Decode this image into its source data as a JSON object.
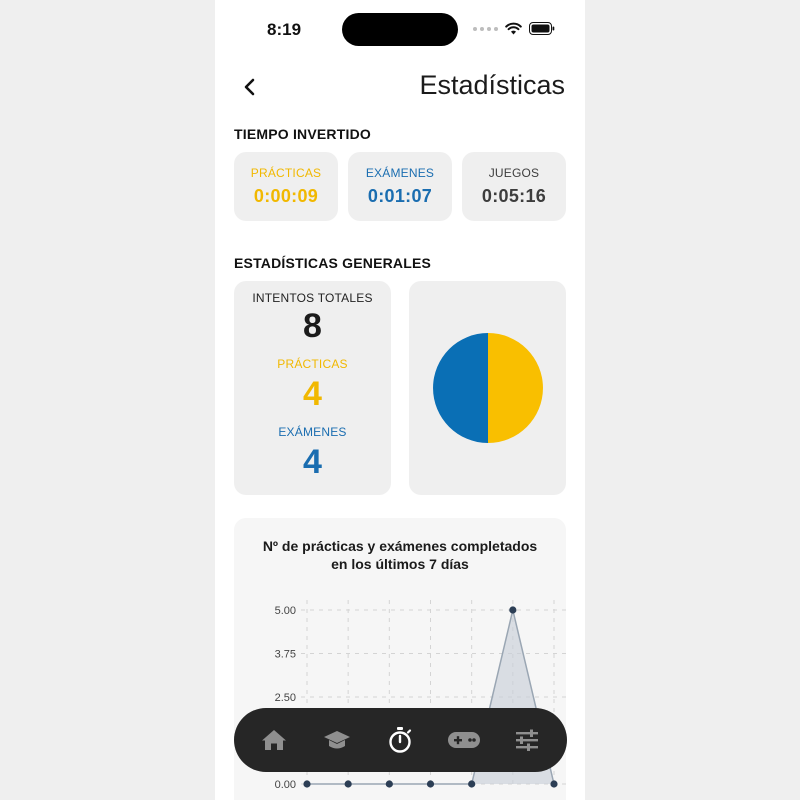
{
  "status_bar": {
    "time": "8:19"
  },
  "header": {
    "title": "Estadísticas",
    "back_icon": "chevron-left-icon"
  },
  "time_spent": {
    "title": "TIEMPO INVERTIDO",
    "cards": [
      {
        "label": "PRÁCTICAS",
        "value": "0:00:09",
        "color": "#f1b800"
      },
      {
        "label": "EXÁMENES",
        "value": "0:01:07",
        "color": "#1a6db0"
      },
      {
        "label": "JUEGOS",
        "value": "0:05:16",
        "color": "#3d3d3d"
      }
    ]
  },
  "general_stats": {
    "title": "ESTADÍSTICAS GENERALES",
    "total_label": "INTENTOS TOTALES",
    "total_value": "8",
    "practices_label": "PRÁCTICAS",
    "practices_value": "4",
    "exams_label": "EXÁMENES",
    "exams_value": "4"
  },
  "pie": {
    "slices": [
      {
        "value": 4,
        "color": "#f9bf00"
      },
      {
        "value": 4,
        "color": "#0a6fb5"
      }
    ]
  },
  "chart_data": {
    "type": "area",
    "title": "Nº de prácticas y exámenes completados en los últimos 7 días",
    "ytick_labels": [
      "5.00",
      "3.75",
      "2.50",
      "0.00"
    ],
    "ylim": [
      0,
      5
    ],
    "series": [
      {
        "values": [
          0,
          0,
          0,
          0,
          0,
          5,
          0
        ]
      }
    ],
    "grid": true
  },
  "nav": {
    "items": [
      {
        "icon": "home-icon",
        "active": false
      },
      {
        "icon": "graduation-cap-icon",
        "active": false
      },
      {
        "icon": "stopwatch-icon",
        "active": true
      },
      {
        "icon": "gamepad-icon",
        "active": false
      },
      {
        "icon": "sliders-icon",
        "active": false
      }
    ]
  },
  "colors": {
    "accent_yellow": "#f1b800",
    "accent_blue": "#1a6db0",
    "nav_bg": "#262626"
  }
}
